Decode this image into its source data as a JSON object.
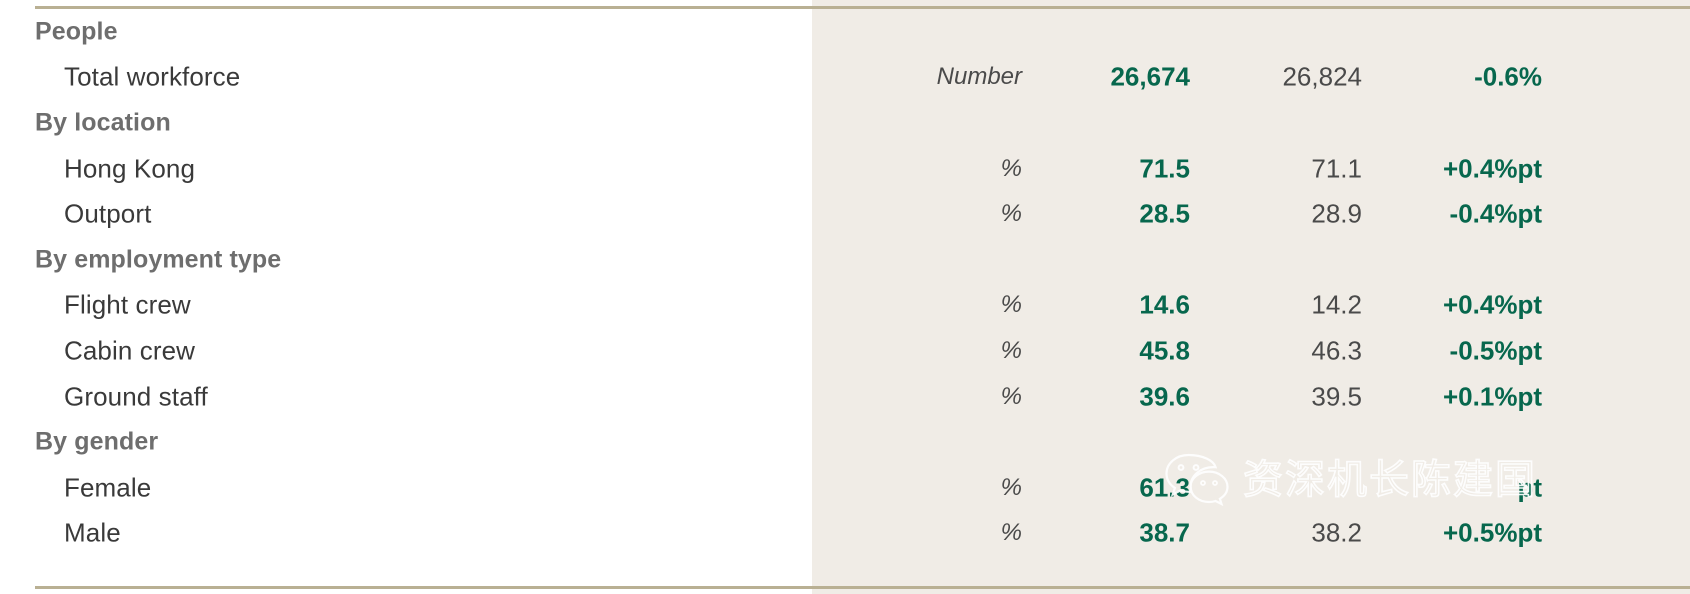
{
  "section": {
    "title": "People"
  },
  "colors": {
    "accent_green": "#07674d",
    "panel_bg": "#f0ece6",
    "rule": "#b9b093",
    "heading_gray": "#6e6e6e",
    "label_gray": "#3a3a3a"
  },
  "rows": [
    {
      "type": "heading",
      "label": "People"
    },
    {
      "type": "item",
      "label": "Total workforce",
      "unit": "Number",
      "current": "26,674",
      "previous": "26,824",
      "delta": "-0.6%"
    },
    {
      "type": "heading",
      "label": "By location"
    },
    {
      "type": "item",
      "label": "Hong Kong",
      "unit": "%",
      "current": "71.5",
      "previous": "71.1",
      "delta": "+0.4%pt"
    },
    {
      "type": "item",
      "label": "Outport",
      "unit": "%",
      "current": "28.5",
      "previous": "28.9",
      "delta": "-0.4%pt"
    },
    {
      "type": "heading",
      "label": "By employment type"
    },
    {
      "type": "item",
      "label": "Flight crew",
      "unit": "%",
      "current": "14.6",
      "previous": "14.2",
      "delta": "+0.4%pt"
    },
    {
      "type": "item",
      "label": "Cabin crew",
      "unit": "%",
      "current": "45.8",
      "previous": "46.3",
      "delta": "-0.5%pt"
    },
    {
      "type": "item",
      "label": "Ground staff",
      "unit": "%",
      "current": "39.6",
      "previous": "39.5",
      "delta": "+0.1%pt"
    },
    {
      "type": "heading",
      "label": "By gender"
    },
    {
      "type": "item",
      "label": "Female",
      "unit": "%",
      "current": "61.3",
      "previous": "",
      "delta": "pt"
    },
    {
      "type": "item",
      "label": "Male",
      "unit": "%",
      "current": "38.7",
      "previous": "38.2",
      "delta": "+0.5%pt"
    }
  ],
  "watermark": {
    "text": "资深机长陈建国",
    "icon": "wechat-logo"
  }
}
